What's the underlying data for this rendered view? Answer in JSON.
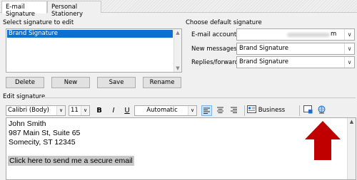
{
  "tabs": [
    {
      "label": "E-mail Signature",
      "active": true
    },
    {
      "label": "Personal Stationery",
      "active": false
    }
  ],
  "select_section": {
    "title": "Select signature to edit",
    "items": [
      "Brand Signature"
    ],
    "buttons": {
      "delete": "Delete",
      "new": "New",
      "save": "Save",
      "rename": "Rename"
    }
  },
  "default_section": {
    "title": "Choose default signature",
    "email_account_label": "E-mail account:",
    "email_account_value": "m",
    "new_messages_label": "New messages:",
    "new_messages_value": "Brand Signature",
    "replies_label": "Replies/forwards:",
    "replies_value": "Brand Signature"
  },
  "edit_section": {
    "title": "Edit signature",
    "font": "Calibri (Body)",
    "size": "11",
    "bold": "B",
    "italic": "I",
    "underline": "U",
    "color": "Automatic",
    "business_card": "Business Card"
  },
  "signature": {
    "lines": [
      "John Smith",
      "987 Main St, Suite 65",
      "Somecity, ST 12345"
    ],
    "link": "Click here to send me a secure email"
  },
  "colors": {
    "selection": "#0b6fd4",
    "arrow": "#c00000",
    "align_selected": "#cce4f7"
  },
  "icons": [
    "down-chevron-icon",
    "align-left-icon",
    "align-center-icon",
    "align-right-icon",
    "business-card-icon",
    "picture-icon",
    "hyperlink-icon",
    "red-arrow-up-icon"
  ]
}
